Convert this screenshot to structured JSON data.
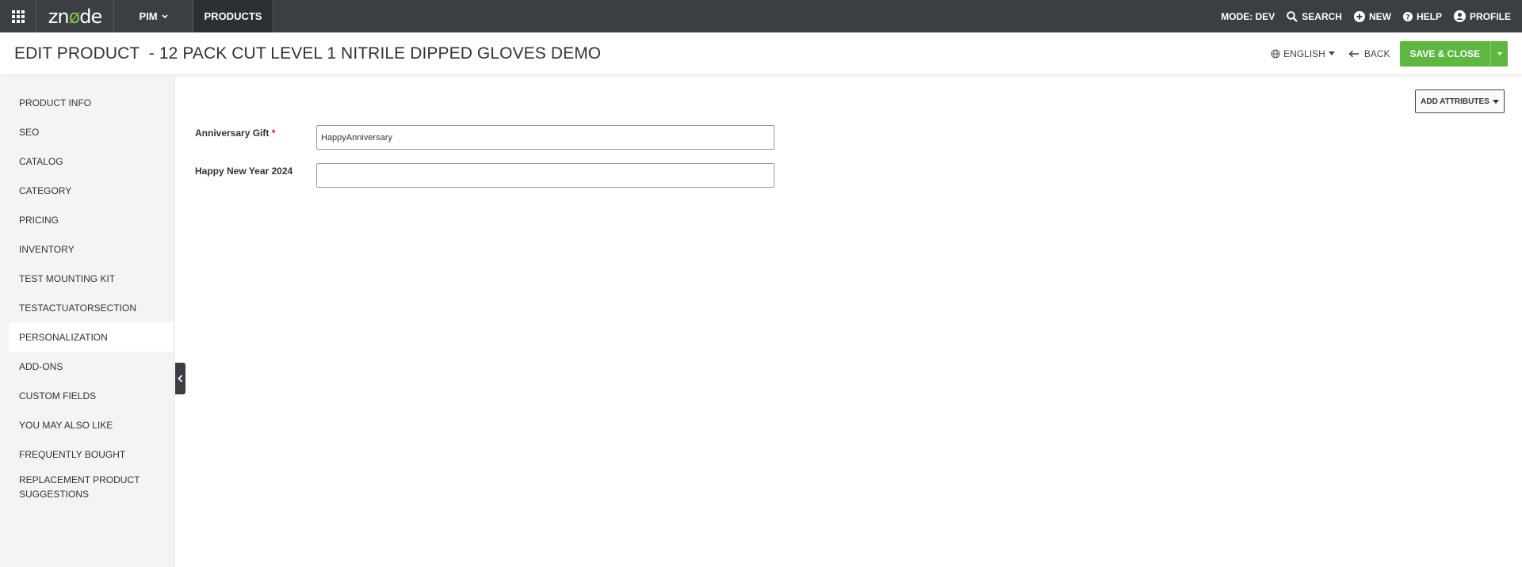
{
  "nav": {
    "logo": {
      "prefix": "zn",
      "leaf": "ø",
      "suffix": "de"
    },
    "pim": "PIM",
    "products": "PRODUCTS",
    "mode": "MODE: DEV",
    "search": "SEARCH",
    "new": "NEW",
    "help": "HELP",
    "profile": "PROFILE"
  },
  "header": {
    "title": "EDIT PRODUCT  - 12 PACK CUT LEVEL 1 NITRILE DIPPED GLOVES DEMO",
    "language": "ENGLISH",
    "back": "BACK",
    "save": "SAVE & CLOSE"
  },
  "sidebar": {
    "items": [
      {
        "label": "PRODUCT INFO"
      },
      {
        "label": "SEO"
      },
      {
        "label": "CATALOG"
      },
      {
        "label": "CATEGORY"
      },
      {
        "label": "PRICING"
      },
      {
        "label": "INVENTORY"
      },
      {
        "label": "TEST MOUNTING KIT"
      },
      {
        "label": "TESTACTUATORSECTION"
      },
      {
        "label": "PERSONALIZATION",
        "active": true
      },
      {
        "label": "ADD-ONS"
      },
      {
        "label": "CUSTOM FIELDS"
      },
      {
        "label": "YOU MAY ALSO LIKE"
      },
      {
        "label": "FREQUENTLY BOUGHT"
      },
      {
        "label": "REPLACEMENT PRODUCT SUGGESTIONS"
      }
    ]
  },
  "main": {
    "add_attributes": "ADD ATTRIBUTES",
    "fields": [
      {
        "label": "Anniversary Gift",
        "required_mark": "*",
        "value": "HappyAnniversary"
      },
      {
        "label": "Happy New Year 2024",
        "value": ""
      }
    ]
  },
  "colors": {
    "nav_bg": "#3b3f44",
    "accent_green": "#5cb840",
    "required": "#ee1122"
  }
}
